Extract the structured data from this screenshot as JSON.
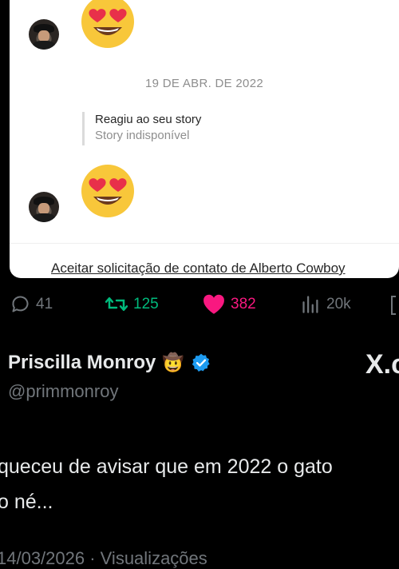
{
  "dm_card": {
    "date_separator": "19 DE ABR. DE 2022",
    "story_reply": {
      "title": "Reagiu ao seu story",
      "subtitle": "Story indisponível"
    },
    "reaction_emoji": "heart-eyes-face",
    "accept_request_text": "Aceitar solicitação de contato de Alberto Cowboy"
  },
  "stats": {
    "replies": "41",
    "retweets": "125",
    "likes": "382",
    "views": "20k",
    "colors": {
      "retweet": "#00ba7c",
      "like": "#f91880",
      "neutral": "#71767b"
    }
  },
  "author": {
    "display_name": "Priscilla Monroy",
    "name_emoji": "🤠",
    "handle": "@primmonroy",
    "verified_color": "#1d9bf0"
  },
  "tweet": {
    "line1": "queceu de avisar que em 2022 o gato",
    "line2": "o né...",
    "meta": "14/03/2026 · Visualizações"
  },
  "brand": {
    "logo_text": "X.c"
  }
}
